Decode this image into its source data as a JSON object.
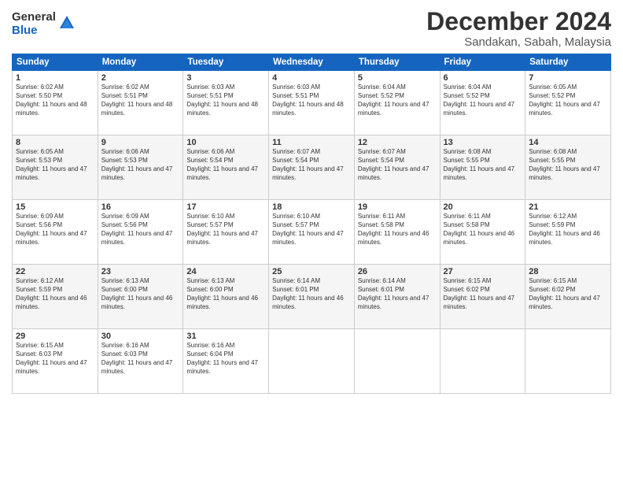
{
  "logo": {
    "general": "General",
    "blue": "Blue"
  },
  "title": "December 2024",
  "subtitle": "Sandakan, Sabah, Malaysia",
  "calendar": {
    "headers": [
      "Sunday",
      "Monday",
      "Tuesday",
      "Wednesday",
      "Thursday",
      "Friday",
      "Saturday"
    ],
    "weeks": [
      [
        {
          "day": "",
          "content": ""
        },
        {
          "day": "",
          "content": ""
        },
        {
          "day": "",
          "content": ""
        },
        {
          "day": "",
          "content": ""
        },
        {
          "day": "",
          "content": ""
        },
        {
          "day": "",
          "content": ""
        },
        {
          "day": "1",
          "sunrise": "Sunrise: 6:05 AM",
          "sunset": "Sunset: 5:52 PM",
          "daylight": "Daylight: 11 hours and 47 minutes."
        }
      ],
      [
        {
          "day": "1",
          "sunrise": "Sunrise: 6:02 AM",
          "sunset": "Sunset: 5:50 PM",
          "daylight": "Daylight: 11 hours and 48 minutes."
        },
        {
          "day": "2",
          "sunrise": "Sunrise: 6:02 AM",
          "sunset": "Sunset: 5:51 PM",
          "daylight": "Daylight: 11 hours and 48 minutes."
        },
        {
          "day": "3",
          "sunrise": "Sunrise: 6:03 AM",
          "sunset": "Sunset: 5:51 PM",
          "daylight": "Daylight: 11 hours and 48 minutes."
        },
        {
          "day": "4",
          "sunrise": "Sunrise: 6:03 AM",
          "sunset": "Sunset: 5:51 PM",
          "daylight": "Daylight: 11 hours and 48 minutes."
        },
        {
          "day": "5",
          "sunrise": "Sunrise: 6:04 AM",
          "sunset": "Sunset: 5:52 PM",
          "daylight": "Daylight: 11 hours and 47 minutes."
        },
        {
          "day": "6",
          "sunrise": "Sunrise: 6:04 AM",
          "sunset": "Sunset: 5:52 PM",
          "daylight": "Daylight: 11 hours and 47 minutes."
        },
        {
          "day": "7",
          "sunrise": "Sunrise: 6:05 AM",
          "sunset": "Sunset: 5:52 PM",
          "daylight": "Daylight: 11 hours and 47 minutes."
        }
      ],
      [
        {
          "day": "8",
          "sunrise": "Sunrise: 6:05 AM",
          "sunset": "Sunset: 5:53 PM",
          "daylight": "Daylight: 11 hours and 47 minutes."
        },
        {
          "day": "9",
          "sunrise": "Sunrise: 6:06 AM",
          "sunset": "Sunset: 5:53 PM",
          "daylight": "Daylight: 11 hours and 47 minutes."
        },
        {
          "day": "10",
          "sunrise": "Sunrise: 6:06 AM",
          "sunset": "Sunset: 5:54 PM",
          "daylight": "Daylight: 11 hours and 47 minutes."
        },
        {
          "day": "11",
          "sunrise": "Sunrise: 6:07 AM",
          "sunset": "Sunset: 5:54 PM",
          "daylight": "Daylight: 11 hours and 47 minutes."
        },
        {
          "day": "12",
          "sunrise": "Sunrise: 6:07 AM",
          "sunset": "Sunset: 5:54 PM",
          "daylight": "Daylight: 11 hours and 47 minutes."
        },
        {
          "day": "13",
          "sunrise": "Sunrise: 6:08 AM",
          "sunset": "Sunset: 5:55 PM",
          "daylight": "Daylight: 11 hours and 47 minutes."
        },
        {
          "day": "14",
          "sunrise": "Sunrise: 6:08 AM",
          "sunset": "Sunset: 5:55 PM",
          "daylight": "Daylight: 11 hours and 47 minutes."
        }
      ],
      [
        {
          "day": "15",
          "sunrise": "Sunrise: 6:09 AM",
          "sunset": "Sunset: 5:56 PM",
          "daylight": "Daylight: 11 hours and 47 minutes."
        },
        {
          "day": "16",
          "sunrise": "Sunrise: 6:09 AM",
          "sunset": "Sunset: 5:56 PM",
          "daylight": "Daylight: 11 hours and 47 minutes."
        },
        {
          "day": "17",
          "sunrise": "Sunrise: 6:10 AM",
          "sunset": "Sunset: 5:57 PM",
          "daylight": "Daylight: 11 hours and 47 minutes."
        },
        {
          "day": "18",
          "sunrise": "Sunrise: 6:10 AM",
          "sunset": "Sunset: 5:57 PM",
          "daylight": "Daylight: 11 hours and 47 minutes."
        },
        {
          "day": "19",
          "sunrise": "Sunrise: 6:11 AM",
          "sunset": "Sunset: 5:58 PM",
          "daylight": "Daylight: 11 hours and 46 minutes."
        },
        {
          "day": "20",
          "sunrise": "Sunrise: 6:11 AM",
          "sunset": "Sunset: 5:58 PM",
          "daylight": "Daylight: 11 hours and 46 minutes."
        },
        {
          "day": "21",
          "sunrise": "Sunrise: 6:12 AM",
          "sunset": "Sunset: 5:59 PM",
          "daylight": "Daylight: 11 hours and 46 minutes."
        }
      ],
      [
        {
          "day": "22",
          "sunrise": "Sunrise: 6:12 AM",
          "sunset": "Sunset: 5:59 PM",
          "daylight": "Daylight: 11 hours and 46 minutes."
        },
        {
          "day": "23",
          "sunrise": "Sunrise: 6:13 AM",
          "sunset": "Sunset: 6:00 PM",
          "daylight": "Daylight: 11 hours and 46 minutes."
        },
        {
          "day": "24",
          "sunrise": "Sunrise: 6:13 AM",
          "sunset": "Sunset: 6:00 PM",
          "daylight": "Daylight: 11 hours and 46 minutes."
        },
        {
          "day": "25",
          "sunrise": "Sunrise: 6:14 AM",
          "sunset": "Sunset: 6:01 PM",
          "daylight": "Daylight: 11 hours and 46 minutes."
        },
        {
          "day": "26",
          "sunrise": "Sunrise: 6:14 AM",
          "sunset": "Sunset: 6:01 PM",
          "daylight": "Daylight: 11 hours and 47 minutes."
        },
        {
          "day": "27",
          "sunrise": "Sunrise: 6:15 AM",
          "sunset": "Sunset: 6:02 PM",
          "daylight": "Daylight: 11 hours and 47 minutes."
        },
        {
          "day": "28",
          "sunrise": "Sunrise: 6:15 AM",
          "sunset": "Sunset: 6:02 PM",
          "daylight": "Daylight: 11 hours and 47 minutes."
        }
      ],
      [
        {
          "day": "29",
          "sunrise": "Sunrise: 6:15 AM",
          "sunset": "Sunset: 6:03 PM",
          "daylight": "Daylight: 11 hours and 47 minutes."
        },
        {
          "day": "30",
          "sunrise": "Sunrise: 6:16 AM",
          "sunset": "Sunset: 6:03 PM",
          "daylight": "Daylight: 11 hours and 47 minutes."
        },
        {
          "day": "31",
          "sunrise": "Sunrise: 6:16 AM",
          "sunset": "Sunset: 6:04 PM",
          "daylight": "Daylight: 11 hours and 47 minutes."
        },
        {
          "day": "",
          "content": ""
        },
        {
          "day": "",
          "content": ""
        },
        {
          "day": "",
          "content": ""
        },
        {
          "day": "",
          "content": ""
        }
      ]
    ]
  }
}
